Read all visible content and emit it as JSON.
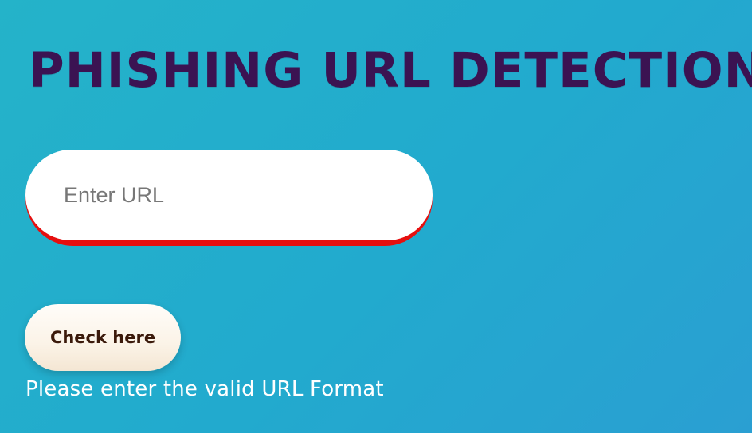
{
  "header": {
    "title": "PHISHING URL DETECTION"
  },
  "form": {
    "url_input": {
      "placeholder": "Enter URL",
      "value": ""
    },
    "check_button_label": "Check here",
    "validation_message": "Please enter the valid URL Format"
  },
  "colors": {
    "background": "#24b3c9",
    "title": "#3b1352",
    "input_accent": "#e60f0f",
    "button_text": "#3b1a0b",
    "message_text": "#ffffff"
  }
}
